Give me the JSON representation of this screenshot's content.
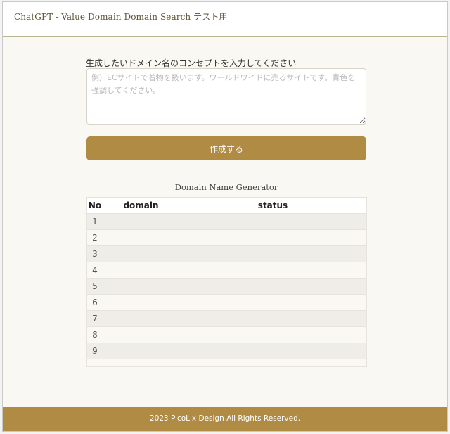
{
  "header": {
    "title": "ChatGPT - Value Domain Domain Search テスト用"
  },
  "form": {
    "label": "生成したいドメイン名のコンセプトを入力してください",
    "placeholder": "例）ECサイトで着物を扱います。ワールドワイドに売るサイトです。青色を強調してください。",
    "value": "",
    "submit_label": "作成する"
  },
  "results": {
    "caption": "Domain Name Generator",
    "columns": [
      "No",
      "domain",
      "status"
    ],
    "rows": [
      {
        "no": "1",
        "domain": "",
        "status": ""
      },
      {
        "no": "2",
        "domain": "",
        "status": ""
      },
      {
        "no": "3",
        "domain": "",
        "status": ""
      },
      {
        "no": "4",
        "domain": "",
        "status": ""
      },
      {
        "no": "5",
        "domain": "",
        "status": ""
      },
      {
        "no": "6",
        "domain": "",
        "status": ""
      },
      {
        "no": "7",
        "domain": "",
        "status": ""
      },
      {
        "no": "8",
        "domain": "",
        "status": ""
      },
      {
        "no": "9",
        "domain": "",
        "status": ""
      },
      {
        "no": "",
        "domain": "",
        "status": ""
      }
    ]
  },
  "footer": {
    "copyright": "2023 PicoLix Design All Rights Reserved."
  },
  "colors": {
    "accent": "#b08b43",
    "background": "#faf8f3",
    "row_stripe": "#efede8"
  }
}
